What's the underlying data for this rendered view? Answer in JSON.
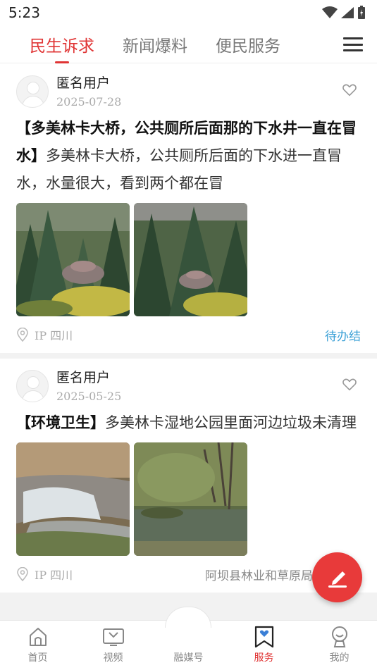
{
  "status_bar": {
    "time": "5:23"
  },
  "top_tabs": [
    {
      "label": "民生诉求",
      "active": true
    },
    {
      "label": "新闻爆料",
      "active": false
    },
    {
      "label": "便民服务",
      "active": false
    }
  ],
  "posts": [
    {
      "user": "匿名用户",
      "date": "2025-07-28",
      "title": "【多美林卡大桥，公共厕所后面那的下水井一直在冒水】",
      "body": "多美林卡大桥，公共厕所后面的下水进一直冒水，水量很大，看到两个都在冒",
      "ip": "IP 四川",
      "status": "待办结",
      "photos": [
        "forest-photo-1",
        "forest-photo-2"
      ]
    },
    {
      "user": "匿名用户",
      "date": "2025-05-25",
      "title": "【环境卫生】",
      "body": "多美林卡湿地公园里面河边垃圾未清理",
      "ip": "IP 四川",
      "status": "阿坝县林业和草原局 - 已办结",
      "photos": [
        "waterfall-photo",
        "river-photo"
      ]
    }
  ],
  "bottom_nav": [
    {
      "label": "首页",
      "icon": "home-icon",
      "active": false
    },
    {
      "label": "视频",
      "icon": "video-icon",
      "active": false
    },
    {
      "label": "融媒号",
      "icon": "media-icon",
      "active": false
    },
    {
      "label": "服务",
      "icon": "service-icon",
      "active": true
    },
    {
      "label": "我的",
      "icon": "profile-icon",
      "active": false
    }
  ],
  "colors": {
    "accent": "#e03535",
    "pending": "#3aa0d6",
    "fab": "#e83a3a"
  }
}
